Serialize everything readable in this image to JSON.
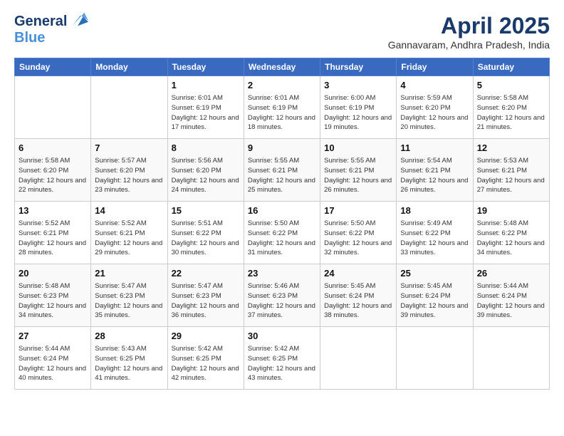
{
  "header": {
    "logo_line1": "General",
    "logo_line2": "Blue",
    "title": "April 2025",
    "subtitle": "Gannavaram, Andhra Pradesh, India"
  },
  "weekdays": [
    "Sunday",
    "Monday",
    "Tuesday",
    "Wednesday",
    "Thursday",
    "Friday",
    "Saturday"
  ],
  "weeks": [
    [
      {
        "day": "",
        "info": ""
      },
      {
        "day": "",
        "info": ""
      },
      {
        "day": "1",
        "info": "Sunrise: 6:01 AM\nSunset: 6:19 PM\nDaylight: 12 hours and 17 minutes."
      },
      {
        "day": "2",
        "info": "Sunrise: 6:01 AM\nSunset: 6:19 PM\nDaylight: 12 hours and 18 minutes."
      },
      {
        "day": "3",
        "info": "Sunrise: 6:00 AM\nSunset: 6:19 PM\nDaylight: 12 hours and 19 minutes."
      },
      {
        "day": "4",
        "info": "Sunrise: 5:59 AM\nSunset: 6:20 PM\nDaylight: 12 hours and 20 minutes."
      },
      {
        "day": "5",
        "info": "Sunrise: 5:58 AM\nSunset: 6:20 PM\nDaylight: 12 hours and 21 minutes."
      }
    ],
    [
      {
        "day": "6",
        "info": "Sunrise: 5:58 AM\nSunset: 6:20 PM\nDaylight: 12 hours and 22 minutes."
      },
      {
        "day": "7",
        "info": "Sunrise: 5:57 AM\nSunset: 6:20 PM\nDaylight: 12 hours and 23 minutes."
      },
      {
        "day": "8",
        "info": "Sunrise: 5:56 AM\nSunset: 6:20 PM\nDaylight: 12 hours and 24 minutes."
      },
      {
        "day": "9",
        "info": "Sunrise: 5:55 AM\nSunset: 6:21 PM\nDaylight: 12 hours and 25 minutes."
      },
      {
        "day": "10",
        "info": "Sunrise: 5:55 AM\nSunset: 6:21 PM\nDaylight: 12 hours and 26 minutes."
      },
      {
        "day": "11",
        "info": "Sunrise: 5:54 AM\nSunset: 6:21 PM\nDaylight: 12 hours and 26 minutes."
      },
      {
        "day": "12",
        "info": "Sunrise: 5:53 AM\nSunset: 6:21 PM\nDaylight: 12 hours and 27 minutes."
      }
    ],
    [
      {
        "day": "13",
        "info": "Sunrise: 5:52 AM\nSunset: 6:21 PM\nDaylight: 12 hours and 28 minutes."
      },
      {
        "day": "14",
        "info": "Sunrise: 5:52 AM\nSunset: 6:21 PM\nDaylight: 12 hours and 29 minutes."
      },
      {
        "day": "15",
        "info": "Sunrise: 5:51 AM\nSunset: 6:22 PM\nDaylight: 12 hours and 30 minutes."
      },
      {
        "day": "16",
        "info": "Sunrise: 5:50 AM\nSunset: 6:22 PM\nDaylight: 12 hours and 31 minutes."
      },
      {
        "day": "17",
        "info": "Sunrise: 5:50 AM\nSunset: 6:22 PM\nDaylight: 12 hours and 32 minutes."
      },
      {
        "day": "18",
        "info": "Sunrise: 5:49 AM\nSunset: 6:22 PM\nDaylight: 12 hours and 33 minutes."
      },
      {
        "day": "19",
        "info": "Sunrise: 5:48 AM\nSunset: 6:22 PM\nDaylight: 12 hours and 34 minutes."
      }
    ],
    [
      {
        "day": "20",
        "info": "Sunrise: 5:48 AM\nSunset: 6:23 PM\nDaylight: 12 hours and 34 minutes."
      },
      {
        "day": "21",
        "info": "Sunrise: 5:47 AM\nSunset: 6:23 PM\nDaylight: 12 hours and 35 minutes."
      },
      {
        "day": "22",
        "info": "Sunrise: 5:47 AM\nSunset: 6:23 PM\nDaylight: 12 hours and 36 minutes."
      },
      {
        "day": "23",
        "info": "Sunrise: 5:46 AM\nSunset: 6:23 PM\nDaylight: 12 hours and 37 minutes."
      },
      {
        "day": "24",
        "info": "Sunrise: 5:45 AM\nSunset: 6:24 PM\nDaylight: 12 hours and 38 minutes."
      },
      {
        "day": "25",
        "info": "Sunrise: 5:45 AM\nSunset: 6:24 PM\nDaylight: 12 hours and 39 minutes."
      },
      {
        "day": "26",
        "info": "Sunrise: 5:44 AM\nSunset: 6:24 PM\nDaylight: 12 hours and 39 minutes."
      }
    ],
    [
      {
        "day": "27",
        "info": "Sunrise: 5:44 AM\nSunset: 6:24 PM\nDaylight: 12 hours and 40 minutes."
      },
      {
        "day": "28",
        "info": "Sunrise: 5:43 AM\nSunset: 6:25 PM\nDaylight: 12 hours and 41 minutes."
      },
      {
        "day": "29",
        "info": "Sunrise: 5:42 AM\nSunset: 6:25 PM\nDaylight: 12 hours and 42 minutes."
      },
      {
        "day": "30",
        "info": "Sunrise: 5:42 AM\nSunset: 6:25 PM\nDaylight: 12 hours and 43 minutes."
      },
      {
        "day": "",
        "info": ""
      },
      {
        "day": "",
        "info": ""
      },
      {
        "day": "",
        "info": ""
      }
    ]
  ]
}
